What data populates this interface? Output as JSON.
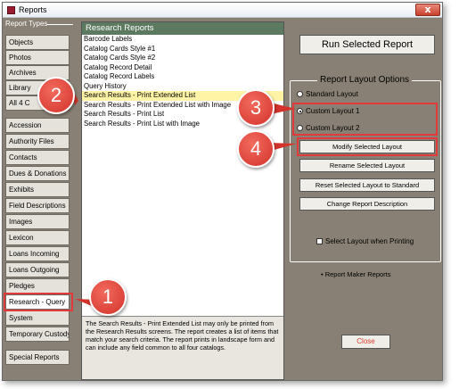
{
  "window": {
    "title": "Reports",
    "close_glyph": "x"
  },
  "report_types": {
    "header": "Report Types",
    "items": [
      "Objects",
      "Photos",
      "Archives",
      "Library",
      "All 4 C",
      "Accession",
      "Authority Files",
      "Contacts",
      "Dues & Donations",
      "Exhibits",
      "Field Descriptions",
      "Images",
      "Lexicon",
      "Loans Incoming",
      "Loans Outgoing",
      "Pledges",
      "Research - Query",
      "System",
      "Temporary Custody"
    ],
    "special_reports": "Special Reports",
    "selected": "Research - Query"
  },
  "research_reports": {
    "header": "Research Reports",
    "items": [
      "Barcode Labels",
      "Catalog Cards Style #1",
      "Catalog Cards Style #2",
      "Catalog Record Detail",
      "Catalog Record Labels",
      "Query History",
      "Search Results - Print Extended List",
      "Search Results - Print Extended List with Image",
      "Search Results - Print List",
      "Search Results - Print List with Image"
    ],
    "selected": "Search Results - Print Extended List",
    "description": "The Search Results - Print Extended List may only be printed from the Research Results screens.  The report creates a list of items that match your search criteria.  The report prints in landscape form and can include any field common to all four catalogs."
  },
  "actions": {
    "run": "Run Selected Report",
    "layout_options_title": "Report Layout Options",
    "layouts": [
      {
        "label": "Standard Layout",
        "checked": false
      },
      {
        "label": "Custom Layout 1",
        "checked": true
      },
      {
        "label": "Custom Layout 2",
        "checked": false
      }
    ],
    "modify": "Modify Selected Layout",
    "rename": "Rename Selected Layout",
    "reset": "Reset Selected Layout to Standard",
    "change_desc": "Change Report Description",
    "select_when_printing": "Select Layout when Printing",
    "report_maker_note": "• Report Maker Reports",
    "close": "Close"
  },
  "callouts": [
    "1",
    "2",
    "3",
    "4"
  ],
  "colors": {
    "window_bg": "#888074",
    "list_header": "#5c7a60",
    "selected_row": "#fff3a6",
    "callout": "#e23a3a",
    "close_text": "#d63a2a"
  }
}
